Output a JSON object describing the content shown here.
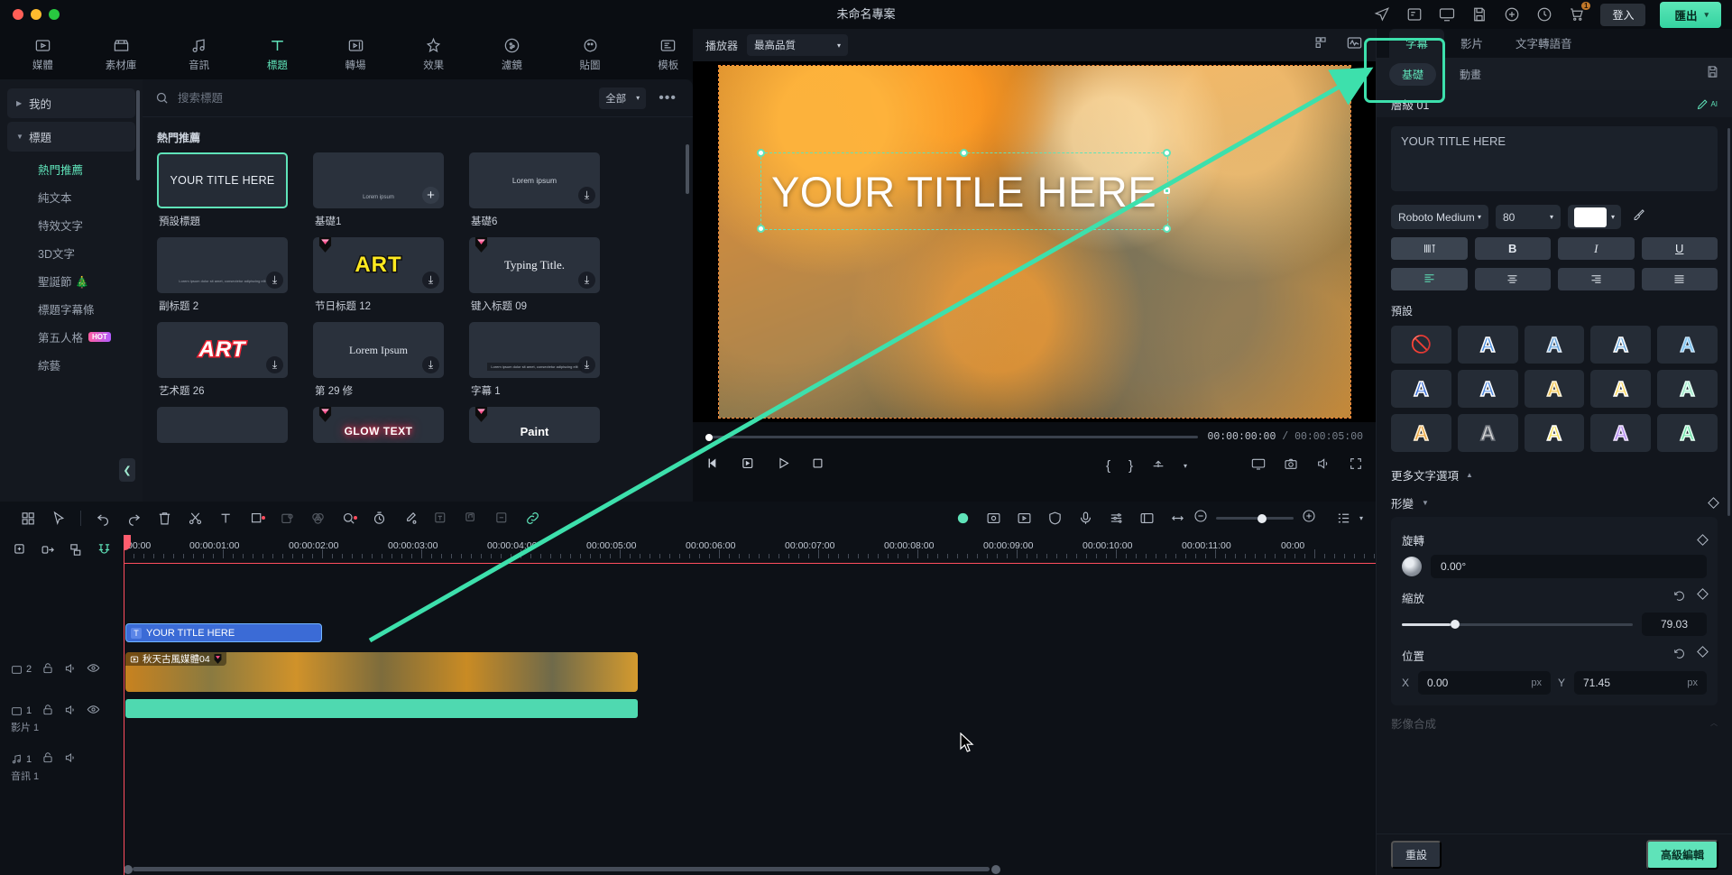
{
  "window": {
    "project_title": "未命名專案"
  },
  "topbar": {
    "icons": [
      "send-icon",
      "record-screen-icon",
      "monitor-icon",
      "save-icon",
      "cloud-icon",
      "clock-history-icon",
      "cart-icon"
    ],
    "cart_badge": "1",
    "login_label": "登入",
    "export_label": "匯出"
  },
  "tabs": [
    {
      "label": "媒體",
      "icon": "media-icon",
      "active": false
    },
    {
      "label": "素材庫",
      "icon": "stock-library-icon",
      "active": false
    },
    {
      "label": "音訊",
      "icon": "audio-icon",
      "active": false
    },
    {
      "label": "標題",
      "icon": "title-icon",
      "active": true
    },
    {
      "label": "轉場",
      "icon": "transition-icon",
      "active": false
    },
    {
      "label": "效果",
      "icon": "effects-icon",
      "active": false
    },
    {
      "label": "濾鏡",
      "icon": "filter-icon",
      "active": false
    },
    {
      "label": "貼圖",
      "icon": "sticker-icon",
      "active": false
    },
    {
      "label": "模板",
      "icon": "template-icon",
      "active": false
    }
  ],
  "library_nav": {
    "groups": [
      {
        "label": "我的",
        "expanded": false
      },
      {
        "label": "標題",
        "expanded": true
      }
    ],
    "items": [
      {
        "label": "熱門推薦",
        "active": true,
        "badge": ""
      },
      {
        "label": "純文本",
        "active": false,
        "badge": ""
      },
      {
        "label": "特效文字",
        "active": false,
        "badge": ""
      },
      {
        "label": "3D文字",
        "active": false,
        "badge": ""
      },
      {
        "label": "聖誕節 🎄",
        "active": false,
        "badge": ""
      },
      {
        "label": "標題字幕條",
        "active": false,
        "badge": ""
      },
      {
        "label": "第五人格",
        "active": false,
        "badge": "HOT"
      },
      {
        "label": "綜藝",
        "active": false,
        "badge": ""
      }
    ]
  },
  "library": {
    "search_placeholder": "搜索標題",
    "filter_label": "全部",
    "section_title": "熱門推薦",
    "cards": [
      {
        "caption": "預設標題",
        "preview": "YOUR TITLE HERE",
        "style": "plain",
        "selected": true,
        "action": "none",
        "gem": false
      },
      {
        "caption": "基礎1",
        "preview": "Lorem ipsum",
        "style": "tiny-bottom",
        "selected": false,
        "action": "add",
        "gem": false
      },
      {
        "caption": "基礎6",
        "preview": "Lorem ipsum",
        "style": "mid-center",
        "selected": false,
        "action": "download",
        "gem": false
      },
      {
        "caption": "副标题 2",
        "preview": "Lorem ipsum dolor sit amet, consectetur adipiscing elit",
        "style": "tiny-para",
        "selected": false,
        "action": "download",
        "gem": false
      },
      {
        "caption": "节日标题 12",
        "preview": "ART",
        "style": "art-yellow",
        "selected": false,
        "action": "download",
        "gem": true
      },
      {
        "caption": "键入标题 09",
        "preview": "Typing Title.",
        "style": "serif-white",
        "selected": false,
        "action": "download",
        "gem": true
      },
      {
        "caption": "艺术题 26",
        "preview": "ART",
        "style": "art-red",
        "selected": false,
        "action": "download",
        "gem": false
      },
      {
        "caption": "第 29 修",
        "preview": "Lorem Ipsum",
        "style": "serif-mid",
        "selected": false,
        "action": "download",
        "gem": false
      },
      {
        "caption": "字幕 1",
        "preview": "Lorem ipsum dolor sit amet, consectetur adipiscing elit",
        "style": "tiny-bar",
        "selected": false,
        "action": "download",
        "gem": false
      },
      {
        "caption": "",
        "preview": "",
        "style": "plain",
        "selected": false,
        "action": "none",
        "gem": false
      },
      {
        "caption": "",
        "preview": "GLOW TEXT",
        "style": "glow",
        "selected": false,
        "action": "none",
        "gem": true
      },
      {
        "caption": "",
        "preview": "Paint",
        "style": "paint",
        "selected": false,
        "action": "none",
        "gem": true
      }
    ]
  },
  "player": {
    "label": "播放器",
    "quality": "最高品質",
    "overlay_text": "YOUR TITLE HERE",
    "current_time": "00:00:00:00",
    "total_time": "00:00:05:00",
    "mark_in": "{",
    "mark_out": "}"
  },
  "properties": {
    "tabs": [
      {
        "label": "字幕",
        "active": true
      },
      {
        "label": "影片",
        "active": false
      },
      {
        "label": "文字轉語音",
        "active": false
      }
    ],
    "chips": [
      {
        "label": "基礎",
        "active": true
      },
      {
        "label": "動畫",
        "active": false
      }
    ],
    "layer_label": "層級 01",
    "ai_label": "AI",
    "text_value": "YOUR TITLE HERE",
    "font_family": "Roboto Medium",
    "font_size": "80",
    "font_color": "#ffffff",
    "style_buttons": [
      "spacing",
      "B",
      "I",
      "U"
    ],
    "align_buttons": [
      "align-left",
      "align-center",
      "align-right",
      "align-justify"
    ],
    "presets_title": "預設",
    "presets": [
      {
        "glyph": "none",
        "color": ""
      },
      {
        "glyph": "A",
        "color": "#4a90e2"
      },
      {
        "glyph": "A",
        "color": "#5b9bd5"
      },
      {
        "glyph": "A",
        "color": "#6aa9e0"
      },
      {
        "glyph": "A",
        "color": "#7fc4f0"
      },
      {
        "glyph": "A",
        "color": "#3a6fd8"
      },
      {
        "glyph": "A",
        "color": "#4f8ae0"
      },
      {
        "glyph": "A",
        "color": "#f0c24b"
      },
      {
        "glyph": "A",
        "color": "#ffd95e"
      },
      {
        "glyph": "A",
        "color": "#9ce8c6"
      },
      {
        "glyph": "A",
        "color": "#e8a33d"
      },
      {
        "glyph": "A",
        "color": "#d8d8d8"
      },
      {
        "glyph": "A",
        "color": "#f2e05a"
      },
      {
        "glyph": "A",
        "color": "#b48cf0"
      },
      {
        "glyph": "A",
        "color": "#6fe0a8"
      }
    ],
    "more_text_options": "更多文字選項",
    "transform_label": "形變",
    "rotation_label": "旋轉",
    "rotation_value": "0.00°",
    "scale_label": "縮放",
    "scale_value": "79.03",
    "position_label": "位置",
    "pos_x_label": "X",
    "pos_x_value": "0.00",
    "pos_x_unit": "px",
    "pos_y_label": "Y",
    "pos_y_value": "71.45",
    "pos_y_unit": "px",
    "compositing_label": "影像合成",
    "reset_label": "重設",
    "advanced_label": "高級編輯"
  },
  "timeline": {
    "ruler_ticks": [
      "00:00",
      "00:00:01:00",
      "00:00:02:00",
      "00:00:03:00",
      "00:00:04:00",
      "00:00:05:00",
      "00:00:06:00",
      "00:00:07:00",
      "00:00:08:00",
      "00:00:09:00",
      "00:00:10:00",
      "00:00:11:00",
      "00:00"
    ],
    "tracks": [
      {
        "index": "2",
        "type": "text",
        "label": "",
        "clip_label": "YOUR TITLE HERE"
      },
      {
        "index": "1",
        "type": "video",
        "label": "影片 1",
        "clip_label": "秋天古風媒體04"
      },
      {
        "index": "1",
        "type": "audio",
        "label": "音訊 1",
        "clip_label": ""
      }
    ]
  },
  "colors": {
    "accent": "#5fe3b9",
    "playhead": "#ff4d5e",
    "text_clip": "#3b6bd6",
    "audio_clip": "#4fd9b0",
    "annotation_arrow": "#3de0ac"
  }
}
